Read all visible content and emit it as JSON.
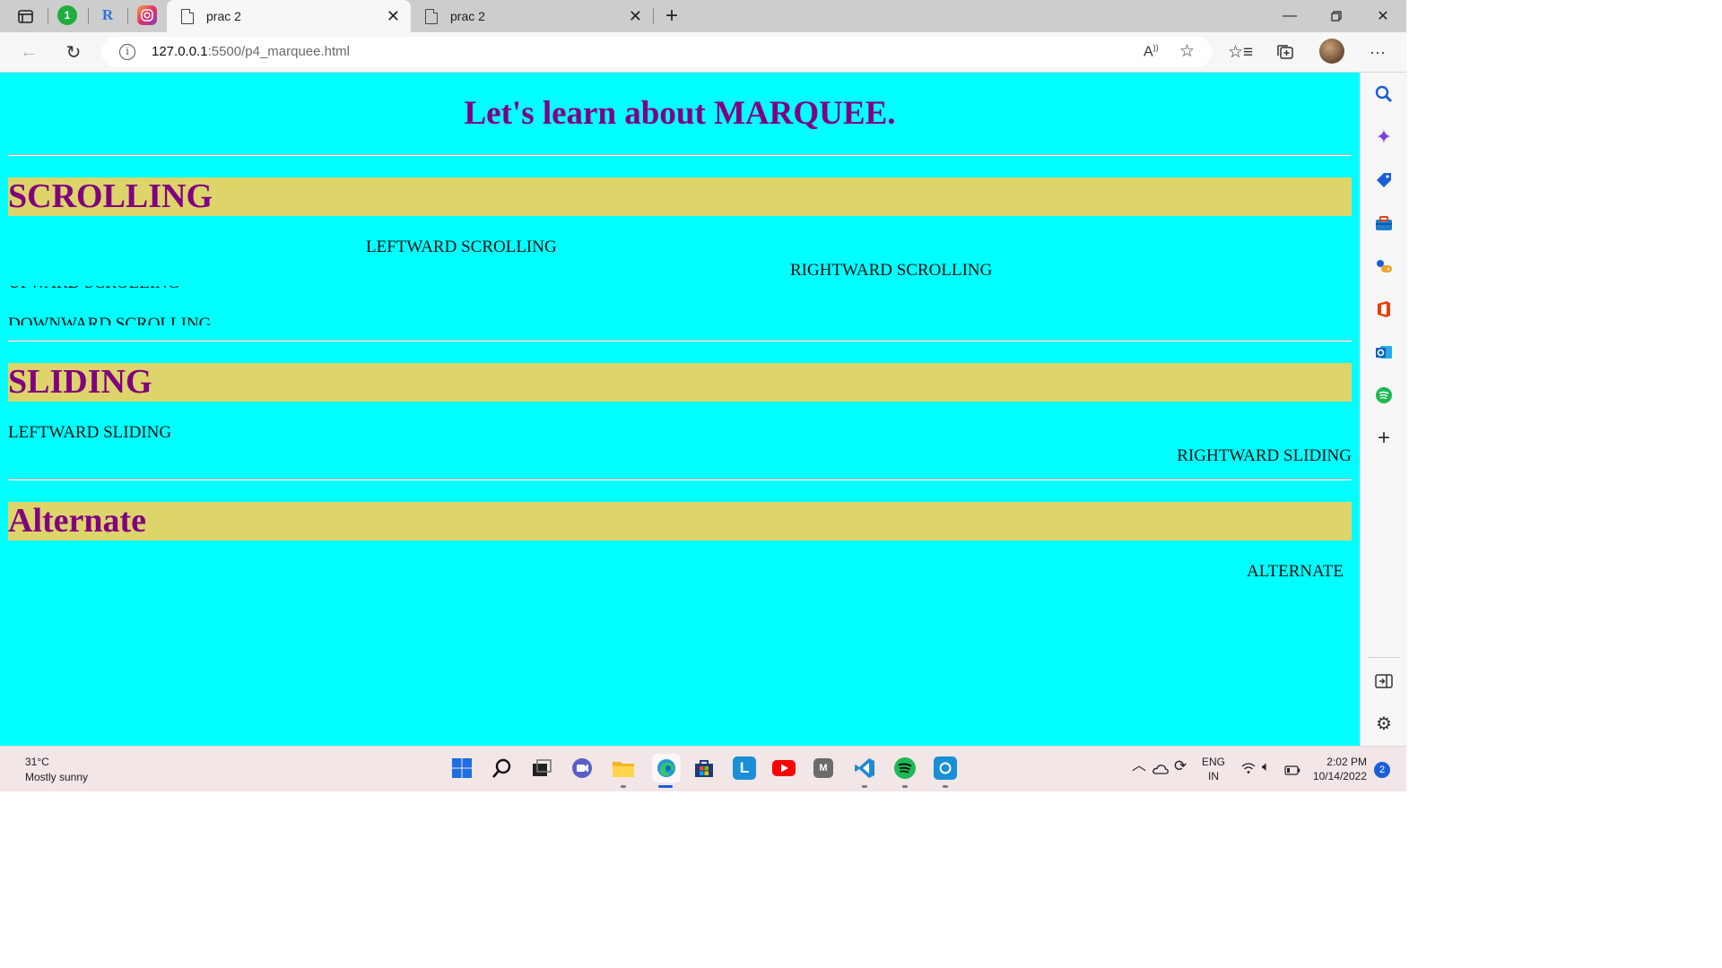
{
  "browser": {
    "pinned_tabs": [
      {
        "icon": "sidebar-toggle-icon"
      },
      {
        "icon": "green-badge-icon",
        "text": "1",
        "color": "#1fae3c"
      },
      {
        "icon": "r-logo-icon",
        "text": "R",
        "color": "#2b73d6"
      },
      {
        "icon": "instagram-icon",
        "color": "#e1306c"
      }
    ],
    "tabs": [
      {
        "title": "prac 2",
        "active": true
      },
      {
        "title": "prac 2",
        "active": false
      }
    ],
    "address": {
      "host": "127.0.0.1",
      "path": ":5500/p4_marquee.html"
    }
  },
  "page": {
    "title": "Let's learn about MARQUEE.",
    "background": "#00ffff",
    "heading_color": "#800080",
    "heading_bg": "#ddd46a",
    "sections": {
      "scrolling": {
        "heading": "SCROLLING",
        "leftward": "LEFTWARD SCROLLING",
        "rightward": "RIGHTWARD SCROLLING",
        "upward": "UPWARD SCROLLING",
        "downward": "DOWNWARD SCROLLING"
      },
      "sliding": {
        "heading": "SLIDING",
        "leftward": "LEFTWARD SLIDING",
        "rightward": "RIGHTWARD SLIDING"
      },
      "alternate": {
        "heading": "Alternate",
        "text": "ALTERNATE"
      }
    }
  },
  "sidebar": {
    "icons": [
      "search-icon",
      "copilot-icon",
      "shopping-tag-icon",
      "tools-icon",
      "games-icon",
      "office-icon",
      "outlook-icon",
      "spotify-icon",
      "add-icon"
    ],
    "bottom_icons": [
      "split-screen-icon",
      "settings-icon"
    ]
  },
  "taskbar": {
    "weather": {
      "temp": "31°C",
      "condition": "Mostly sunny"
    },
    "apps": [
      "windows-start-icon",
      "search-icon",
      "task-view-icon",
      "teams-chat-icon",
      "file-explorer-icon",
      "edge-icon",
      "store-icon",
      "l-app-icon",
      "youtube-icon",
      "m-app-icon",
      "vscode-icon",
      "spotify-icon",
      "cortana-icon"
    ],
    "tray": {
      "lang_top": "ENG",
      "lang_bottom": "IN",
      "time": "2:02 PM",
      "date": "10/14/2022",
      "notifications": "2"
    }
  }
}
